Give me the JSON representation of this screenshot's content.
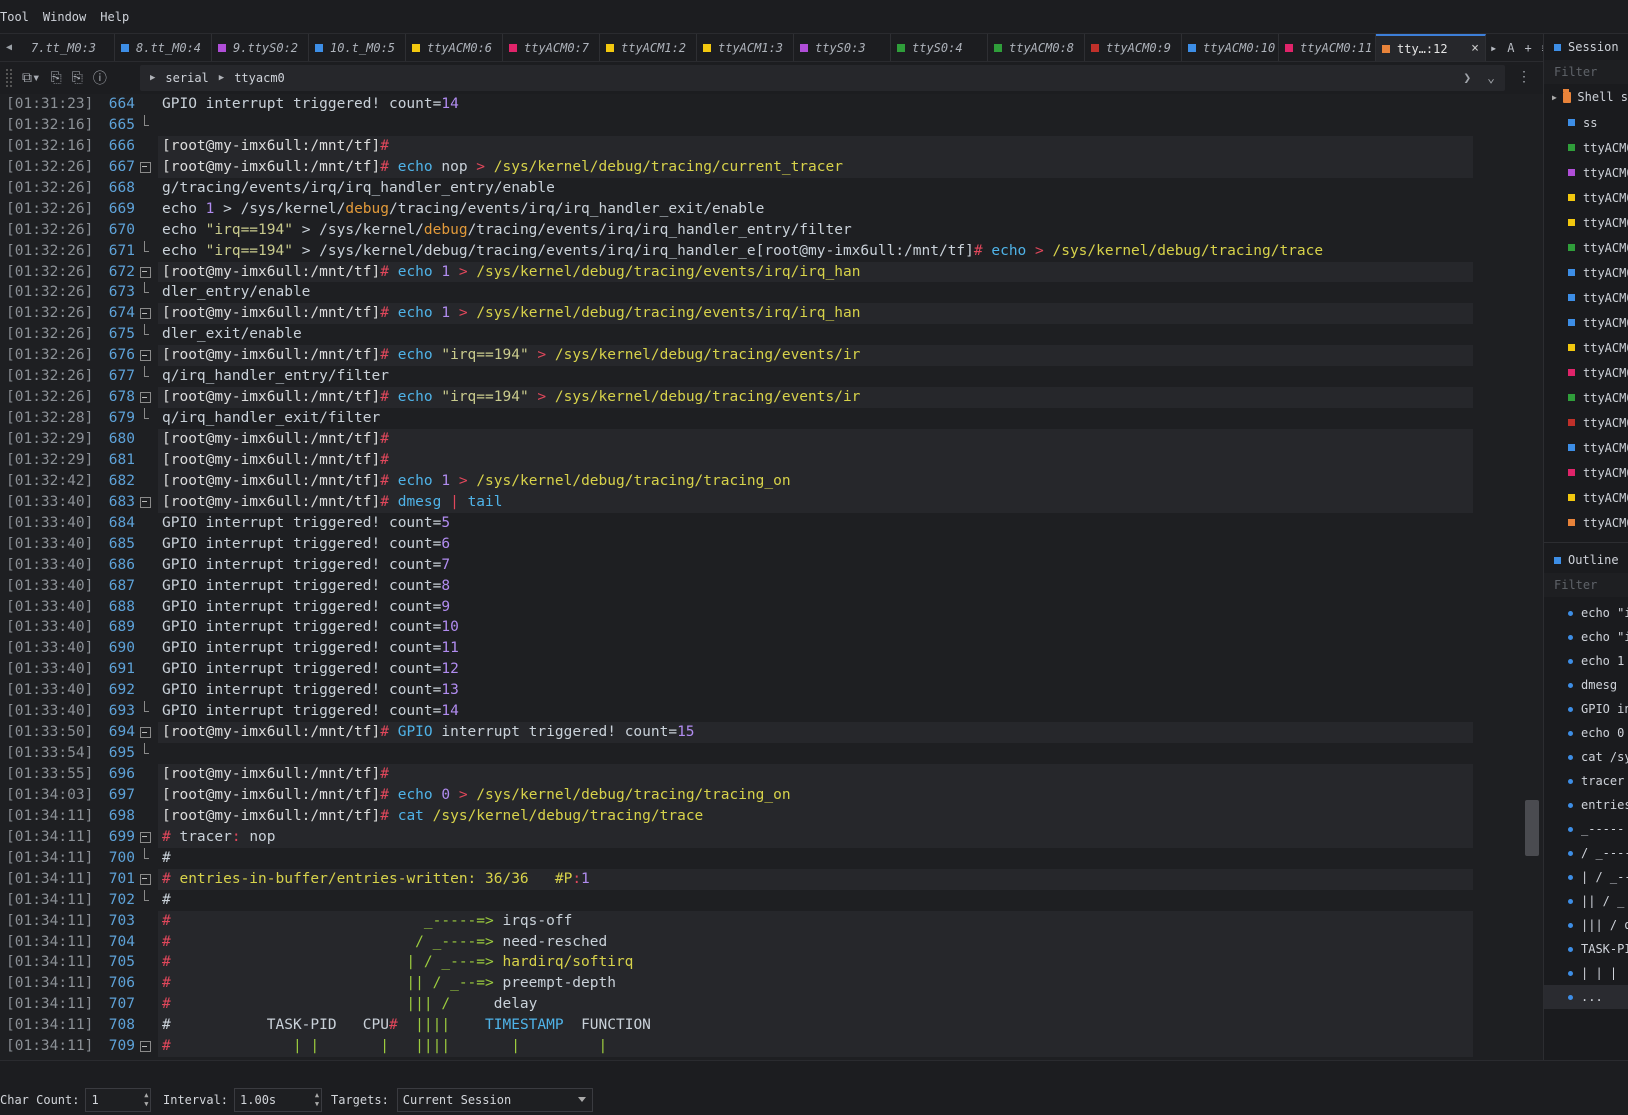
{
  "menu": [
    "Tool",
    "Window",
    "Help"
  ],
  "tabs": [
    {
      "label": "7.tt_M0:3",
      "color": ""
    },
    {
      "label": "8.tt_M0:4",
      "color": "#3d8ee6"
    },
    {
      "label": "9.ttyS0:2",
      "color": "#b04ed8"
    },
    {
      "label": "10.t_M0:5",
      "color": "#3d8ee6"
    },
    {
      "label": "ttyACM0:6",
      "color": "#f2c80f"
    },
    {
      "label": "ttyACM0:7",
      "color": "#e0246a"
    },
    {
      "label": "ttyACM1:2",
      "color": "#f2c80f"
    },
    {
      "label": "ttyACM1:3",
      "color": "#f2c80f"
    },
    {
      "label": "ttyS0:3",
      "color": "#b04ed8"
    },
    {
      "label": "ttyS0:4",
      "color": "#2f9e3a"
    },
    {
      "label": "ttyACM0:8",
      "color": "#2f9e3a"
    },
    {
      "label": "ttyACM0:9",
      "color": "#c0302a"
    },
    {
      "label": "ttyACM0:10",
      "color": "#3d8ee6"
    },
    {
      "label": "ttyACM0:11",
      "color": "#e0246a"
    }
  ],
  "active_tab": {
    "label": "tty…:12",
    "color": "#e8833a",
    "close": "×"
  },
  "tab_tools": {
    "next": "▸",
    "a": "A",
    "add": "+",
    "menu": "≡"
  },
  "breadcrumb": {
    "root": "serial",
    "leaf": "ttyacm0"
  },
  "terminal": {
    "lines": [
      {
        "ts": "[01:31:23]",
        "ln": "664",
        "fold": "",
        "hl": false,
        "parts": [
          [
            "GPIO interrupt triggered! count=",
            "gray"
          ],
          [
            "14",
            "num"
          ]
        ]
      },
      {
        "ts": "[01:32:16]",
        "ln": "665",
        "fold": "end",
        "hl": false,
        "parts": []
      },
      {
        "ts": "[01:32:16]",
        "ln": "666",
        "fold": "",
        "hl": true,
        "parts": [
          [
            "[root@my-imx6ull:/mnt/tf]",
            "prompt"
          ],
          [
            "#",
            "hash"
          ]
        ]
      },
      {
        "ts": "[01:32:26]",
        "ln": "667",
        "fold": "box",
        "hl": true,
        "parts": [
          [
            "[root@my-imx6ull:/mnt/tf]",
            "prompt"
          ],
          [
            "# ",
            "hash"
          ],
          [
            "echo",
            "cmd"
          ],
          [
            " nop ",
            "gray"
          ],
          [
            "> ",
            "hash"
          ],
          [
            "/sys/kernel/debug/tracing/current_tracer",
            "path"
          ]
        ]
      },
      {
        "ts": "[01:32:26]",
        "ln": "668",
        "fold": "",
        "hl": false,
        "parts": [
          [
            "g/tracing/events/irq/irq_handler_entry/enable",
            "gray"
          ]
        ]
      },
      {
        "ts": "[01:32:26]",
        "ln": "669",
        "fold": "",
        "hl": false,
        "parts": [
          [
            "echo ",
            "gray"
          ],
          [
            "1",
            "num"
          ],
          [
            " > /sys/kernel/",
            "gray"
          ],
          [
            "debug",
            "orange"
          ],
          [
            "/tracing/events/irq/irq_handler_exit/enable",
            "gray"
          ]
        ]
      },
      {
        "ts": "[01:32:26]",
        "ln": "670",
        "fold": "",
        "hl": false,
        "parts": [
          [
            "echo ",
            "gray"
          ],
          [
            "\"irq==194\"",
            "str"
          ],
          [
            " > /sys/kernel/",
            "gray"
          ],
          [
            "debug",
            "orange"
          ],
          [
            "/tracing/events/irq/irq_handler_entry/filter",
            "gray"
          ]
        ]
      },
      {
        "ts": "[01:32:26]",
        "ln": "671",
        "fold": "end",
        "hl": false,
        "parts": [
          [
            "echo ",
            "gray"
          ],
          [
            "\"irq==194\"",
            "str"
          ],
          [
            " > /sys/kernel/debug/tracing/events/irq/irq_handler_e[root@my-imx6ull:/mnt/tf]",
            "gray"
          ],
          [
            "# ",
            "hash"
          ],
          [
            "echo",
            "cmd"
          ],
          [
            " > ",
            "hash"
          ],
          [
            "/sys/kernel/debug/tracing/trace",
            "path"
          ]
        ]
      },
      {
        "ts": "[01:32:26]",
        "ln": "672",
        "fold": "box",
        "hl": true,
        "parts": [
          [
            "[root@my-imx6ull:/mnt/tf]",
            "prompt"
          ],
          [
            "# ",
            "hash"
          ],
          [
            "echo",
            "cmd"
          ],
          [
            " 1 ",
            "num"
          ],
          [
            "> ",
            "hash"
          ],
          [
            "/sys/kernel/debug/tracing/events/irq/irq_han",
            "path"
          ]
        ]
      },
      {
        "ts": "[01:32:26]",
        "ln": "673",
        "fold": "end",
        "hl": false,
        "parts": [
          [
            "dler_entry/enable",
            "gray"
          ]
        ]
      },
      {
        "ts": "[01:32:26]",
        "ln": "674",
        "fold": "box",
        "hl": true,
        "parts": [
          [
            "[root@my-imx6ull:/mnt/tf]",
            "prompt"
          ],
          [
            "# ",
            "hash"
          ],
          [
            "echo",
            "cmd"
          ],
          [
            " 1 ",
            "num"
          ],
          [
            "> ",
            "hash"
          ],
          [
            "/sys/kernel/debug/tracing/events/irq/irq_han",
            "path"
          ]
        ]
      },
      {
        "ts": "[01:32:26]",
        "ln": "675",
        "fold": "end",
        "hl": false,
        "parts": [
          [
            "dler_exit/enable",
            "gray"
          ]
        ]
      },
      {
        "ts": "[01:32:26]",
        "ln": "676",
        "fold": "box",
        "hl": true,
        "parts": [
          [
            "[root@my-imx6ull:/mnt/tf]",
            "prompt"
          ],
          [
            "# ",
            "hash"
          ],
          [
            "echo",
            "cmd"
          ],
          [
            " \"irq==194\" ",
            "str"
          ],
          [
            "> ",
            "hash"
          ],
          [
            "/sys/kernel/debug/tracing/events/ir",
            "path"
          ]
        ]
      },
      {
        "ts": "[01:32:26]",
        "ln": "677",
        "fold": "end",
        "hl": false,
        "parts": [
          [
            "q/irq_handler_entry/filter",
            "gray"
          ]
        ]
      },
      {
        "ts": "[01:32:26]",
        "ln": "678",
        "fold": "box",
        "hl": true,
        "parts": [
          [
            "[root@my-imx6ull:/mnt/tf]",
            "prompt"
          ],
          [
            "# ",
            "hash"
          ],
          [
            "echo",
            "cmd"
          ],
          [
            " \"irq==194\" ",
            "str"
          ],
          [
            "> ",
            "hash"
          ],
          [
            "/sys/kernel/debug/tracing/events/ir",
            "path"
          ]
        ]
      },
      {
        "ts": "[01:32:28]",
        "ln": "679",
        "fold": "end",
        "hl": false,
        "parts": [
          [
            "q/irq_handler_exit/filter",
            "gray"
          ]
        ]
      },
      {
        "ts": "[01:32:29]",
        "ln": "680",
        "fold": "",
        "hl": true,
        "parts": [
          [
            "[root@my-imx6ull:/mnt/tf]",
            "prompt"
          ],
          [
            "#",
            "hash"
          ]
        ]
      },
      {
        "ts": "[01:32:29]",
        "ln": "681",
        "fold": "",
        "hl": true,
        "parts": [
          [
            "[root@my-imx6ull:/mnt/tf]",
            "prompt"
          ],
          [
            "#",
            "hash"
          ]
        ]
      },
      {
        "ts": "[01:32:42]",
        "ln": "682",
        "fold": "",
        "hl": true,
        "parts": [
          [
            "[root@my-imx6ull:/mnt/tf]",
            "prompt"
          ],
          [
            "# ",
            "hash"
          ],
          [
            "echo",
            "cmd"
          ],
          [
            " 1 ",
            "num"
          ],
          [
            "> ",
            "hash"
          ],
          [
            "/sys/kernel/debug/tracing/tracing_on",
            "path"
          ]
        ]
      },
      {
        "ts": "[01:33:40]",
        "ln": "683",
        "fold": "box",
        "hl": true,
        "parts": [
          [
            "[root@my-imx6ull:/mnt/tf]",
            "prompt"
          ],
          [
            "# ",
            "hash"
          ],
          [
            "dmesg",
            "cmd"
          ],
          [
            " | ",
            "hash"
          ],
          [
            "tail",
            "cmd"
          ]
        ]
      },
      {
        "ts": "[01:33:40]",
        "ln": "684",
        "fold": "",
        "hl": false,
        "parts": [
          [
            "GPIO interrupt triggered! count=",
            "gray"
          ],
          [
            "5",
            "num"
          ]
        ]
      },
      {
        "ts": "[01:33:40]",
        "ln": "685",
        "fold": "",
        "hl": false,
        "parts": [
          [
            "GPIO interrupt triggered! count=",
            "gray"
          ],
          [
            "6",
            "num"
          ]
        ]
      },
      {
        "ts": "[01:33:40]",
        "ln": "686",
        "fold": "",
        "hl": false,
        "parts": [
          [
            "GPIO interrupt triggered! count=",
            "gray"
          ],
          [
            "7",
            "num"
          ]
        ]
      },
      {
        "ts": "[01:33:40]",
        "ln": "687",
        "fold": "",
        "hl": false,
        "parts": [
          [
            "GPIO interrupt triggered! count=",
            "gray"
          ],
          [
            "8",
            "num"
          ]
        ]
      },
      {
        "ts": "[01:33:40]",
        "ln": "688",
        "fold": "",
        "hl": false,
        "parts": [
          [
            "GPIO interrupt triggered! count=",
            "gray"
          ],
          [
            "9",
            "num"
          ]
        ]
      },
      {
        "ts": "[01:33:40]",
        "ln": "689",
        "fold": "",
        "hl": false,
        "parts": [
          [
            "GPIO interrupt triggered! count=",
            "gray"
          ],
          [
            "10",
            "num"
          ]
        ]
      },
      {
        "ts": "[01:33:40]",
        "ln": "690",
        "fold": "",
        "hl": false,
        "parts": [
          [
            "GPIO interrupt triggered! count=",
            "gray"
          ],
          [
            "11",
            "num"
          ]
        ]
      },
      {
        "ts": "[01:33:40]",
        "ln": "691",
        "fold": "",
        "hl": false,
        "parts": [
          [
            "GPIO interrupt triggered! count=",
            "gray"
          ],
          [
            "12",
            "num"
          ]
        ]
      },
      {
        "ts": "[01:33:40]",
        "ln": "692",
        "fold": "",
        "hl": false,
        "parts": [
          [
            "GPIO interrupt triggered! count=",
            "gray"
          ],
          [
            "13",
            "num"
          ]
        ]
      },
      {
        "ts": "[01:33:40]",
        "ln": "693",
        "fold": "end",
        "hl": false,
        "parts": [
          [
            "GPIO interrupt triggered! count=",
            "gray"
          ],
          [
            "14",
            "num"
          ]
        ]
      },
      {
        "ts": "[01:33:50]",
        "ln": "694",
        "fold": "box",
        "hl": true,
        "parts": [
          [
            "[root@my-imx6ull:/mnt/tf]",
            "prompt"
          ],
          [
            "# ",
            "hash"
          ],
          [
            "GPIO",
            "cmd"
          ],
          [
            " interrupt triggered! count=",
            "gray"
          ],
          [
            "15",
            "num"
          ]
        ]
      },
      {
        "ts": "[01:33:54]",
        "ln": "695",
        "fold": "end",
        "hl": false,
        "parts": []
      },
      {
        "ts": "[01:33:55]",
        "ln": "696",
        "fold": "",
        "hl": true,
        "parts": [
          [
            "[root@my-imx6ull:/mnt/tf]",
            "prompt"
          ],
          [
            "#",
            "hash"
          ]
        ]
      },
      {
        "ts": "[01:34:03]",
        "ln": "697",
        "fold": "",
        "hl": true,
        "parts": [
          [
            "[root@my-imx6ull:/mnt/tf]",
            "prompt"
          ],
          [
            "# ",
            "hash"
          ],
          [
            "echo",
            "cmd"
          ],
          [
            " 0 ",
            "num"
          ],
          [
            "> ",
            "hash"
          ],
          [
            "/sys/kernel/debug/tracing/tracing_on",
            "path"
          ]
        ]
      },
      {
        "ts": "[01:34:11]",
        "ln": "698",
        "fold": "",
        "hl": true,
        "parts": [
          [
            "[root@my-imx6ull:/mnt/tf]",
            "prompt"
          ],
          [
            "# ",
            "hash"
          ],
          [
            "cat",
            "cmd"
          ],
          [
            " /sys/kernel/debug/tracing/trace",
            "path"
          ]
        ]
      },
      {
        "ts": "[01:34:11]",
        "ln": "699",
        "fold": "box",
        "hl": true,
        "parts": [
          [
            "# ",
            "hash"
          ],
          [
            "tracer",
            "gray"
          ],
          [
            ": ",
            "hash"
          ],
          [
            "nop",
            "gray"
          ]
        ]
      },
      {
        "ts": "[01:34:11]",
        "ln": "700",
        "fold": "end",
        "hl": false,
        "parts": [
          [
            "#",
            "gray"
          ]
        ]
      },
      {
        "ts": "[01:34:11]",
        "ln": "701",
        "fold": "box",
        "hl": true,
        "parts": [
          [
            "# ",
            "hash"
          ],
          [
            "entries-in-buffer/entries-written: 36/36   #P",
            "path"
          ],
          [
            ":",
            "hash"
          ],
          [
            "1",
            "num"
          ]
        ]
      },
      {
        "ts": "[01:34:11]",
        "ln": "702",
        "fold": "end",
        "hl": false,
        "parts": [
          [
            "#",
            "gray"
          ]
        ]
      },
      {
        "ts": "[01:34:11]",
        "ln": "703",
        "fold": "",
        "hl": true,
        "parts": [
          [
            "#",
            "hash"
          ],
          [
            "                             _-----=> ",
            "green"
          ],
          [
            "irqs-off",
            "gray"
          ]
        ]
      },
      {
        "ts": "[01:34:11]",
        "ln": "704",
        "fold": "",
        "hl": true,
        "parts": [
          [
            "#",
            "hash"
          ],
          [
            "                            / _----=> ",
            "green"
          ],
          [
            "need-resched",
            "gray"
          ]
        ]
      },
      {
        "ts": "[01:34:11]",
        "ln": "705",
        "fold": "",
        "hl": true,
        "parts": [
          [
            "#",
            "hash"
          ],
          [
            "                           | / _---=> ",
            "green"
          ],
          [
            "hardirq/softirq",
            "path"
          ]
        ]
      },
      {
        "ts": "[01:34:11]",
        "ln": "706",
        "fold": "",
        "hl": true,
        "parts": [
          [
            "#",
            "hash"
          ],
          [
            "                           || / _--=> ",
            "green"
          ],
          [
            "preempt-depth",
            "gray"
          ]
        ]
      },
      {
        "ts": "[01:34:11]",
        "ln": "707",
        "fold": "",
        "hl": true,
        "parts": [
          [
            "#",
            "hash"
          ],
          [
            "                           ||| / ",
            "green"
          ],
          [
            "    delay",
            "gray"
          ]
        ]
      },
      {
        "ts": "[01:34:11]",
        "ln": "708",
        "fold": "",
        "hl": true,
        "parts": [
          [
            "#           TASK-PID   CPU",
            "gray"
          ],
          [
            "#",
            "hash"
          ],
          [
            "  ||||    ",
            "green"
          ],
          [
            "TIMESTAMP",
            "cmd"
          ],
          [
            "  FUNCTION",
            "gray"
          ]
        ]
      },
      {
        "ts": "[01:34:11]",
        "ln": "709",
        "fold": "box",
        "hl": true,
        "parts": [
          [
            "#",
            "hash"
          ],
          [
            "              | |       |   ||||       |         |",
            "green"
          ]
        ]
      }
    ]
  },
  "session_panel": {
    "title": "Session",
    "filter_placeholder": "Filter",
    "folder": "Shell s",
    "items": [
      {
        "label": "ss",
        "color": "#3d8ee6"
      },
      {
        "label": "ttyACM0",
        "color": "#2f9e3a"
      },
      {
        "label": "ttyACM0",
        "color": "#b04ed8"
      },
      {
        "label": "ttyACM0",
        "color": "#f2c80f"
      },
      {
        "label": "ttyACM0",
        "color": "#f2c80f"
      },
      {
        "label": "ttyACM0",
        "color": "#2f9e3a"
      },
      {
        "label": "ttyACM0",
        "color": "#3d8ee6"
      },
      {
        "label": "ttyACM0",
        "color": "#3d8ee6"
      },
      {
        "label": "ttyACM0",
        "color": "#3d8ee6"
      },
      {
        "label": "ttyACM0",
        "color": "#f2c80f"
      },
      {
        "label": "ttyACM0",
        "color": "#e0246a"
      },
      {
        "label": "ttyACM0",
        "color": "#2f9e3a"
      },
      {
        "label": "ttyACM0",
        "color": "#c0302a"
      },
      {
        "label": "ttyACM0",
        "color": "#3d8ee6"
      },
      {
        "label": "ttyACM0",
        "color": "#e0246a"
      },
      {
        "label": "ttyACM0",
        "color": "#f2c80f"
      },
      {
        "label": "ttyACM0",
        "color": "#e8833a"
      }
    ]
  },
  "outline_panel": {
    "title": "Outline",
    "filter_placeholder": "Filter",
    "items": [
      "echo \"i",
      "echo \"i",
      "echo 1",
      "dmesg",
      "GPIO in",
      "echo 0",
      "cat /sy",
      "tracer",
      "entries",
      "_-----",
      "/ _----",
      "| / _--",
      "|| / _",
      "||| / d",
      "TASK-PI",
      "| | |",
      "..."
    ]
  },
  "bottom": {
    "char_count_label": "Char Count:",
    "char_count_value": "1",
    "interval_label": "Interval:",
    "interval_value": "1.00s",
    "targets_label": "Targets:",
    "targets_value": "Current Session"
  }
}
